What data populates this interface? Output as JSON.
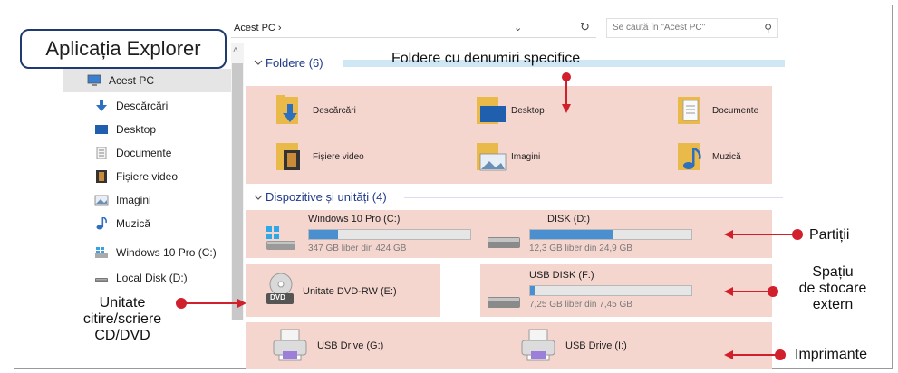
{
  "window": {
    "address": "Acest PC  ›",
    "search_placeholder": "Se caută în \"Acest PC\""
  },
  "callouts": {
    "title": "Aplicația Explorer",
    "folders_note": "Foldere cu denumiri specifice",
    "partitions": "Partiții",
    "external_storage": [
      "Spațiu",
      "de stocare",
      "extern"
    ],
    "optical_drive": [
      "Unitate",
      "citire/scriere",
      "CD/DVD"
    ],
    "printers": "Imprimante"
  },
  "nav": {
    "items": [
      {
        "label": "Acest PC",
        "icon": "computer-icon",
        "selected": true
      },
      {
        "label": "Descărcări",
        "icon": "download-icon"
      },
      {
        "label": "Desktop",
        "icon": "desktop-icon"
      },
      {
        "label": "Documente",
        "icon": "document-icon"
      },
      {
        "label": "Fișiere video",
        "icon": "video-icon"
      },
      {
        "label": "Imagini",
        "icon": "pictures-icon"
      },
      {
        "label": "Muzică",
        "icon": "music-icon"
      },
      {
        "label": "Windows 10 Pro  (C:)",
        "icon": "windows-drive-icon"
      },
      {
        "label": "Local Disk (D:)",
        "icon": "disk-icon"
      }
    ]
  },
  "folders": {
    "header": "Foldere (6)",
    "items": [
      {
        "label": "Descărcări",
        "icon": "download-folder-icon"
      },
      {
        "label": "Desktop",
        "icon": "desktop-folder-icon"
      },
      {
        "label": "Documente",
        "icon": "documents-folder-icon"
      },
      {
        "label": "Fișiere video",
        "icon": "video-folder-icon"
      },
      {
        "label": "Imagini",
        "icon": "pictures-folder-icon"
      },
      {
        "label": "Muzică",
        "icon": "music-folder-icon"
      }
    ]
  },
  "devices": {
    "header": "Dispozitive și unități (4)",
    "drives": [
      {
        "name": "Windows 10 Pro  (C:)",
        "free": "347 GB liber din 424 GB",
        "used_fraction": 0.18
      },
      {
        "name": "DISK  (D:)",
        "free": "12,3 GB liber din 24,9 GB",
        "used_fraction": 0.51
      },
      {
        "name": "Unitate DVD-RW (E:)",
        "icon_text": "DVD"
      },
      {
        "name": "USB DISK (F:)",
        "free": "7,25 GB liber din 7,45 GB",
        "used_fraction": 0.03
      }
    ],
    "printers": [
      {
        "name": "USB Drive (G:)"
      },
      {
        "name": "USB Drive (I:)"
      }
    ]
  },
  "colors": {
    "highlight": "#f5d6cf",
    "arrow": "#d11f2c",
    "header_text": "#1f3a8a",
    "bar_fill": "#4a8fd0"
  }
}
